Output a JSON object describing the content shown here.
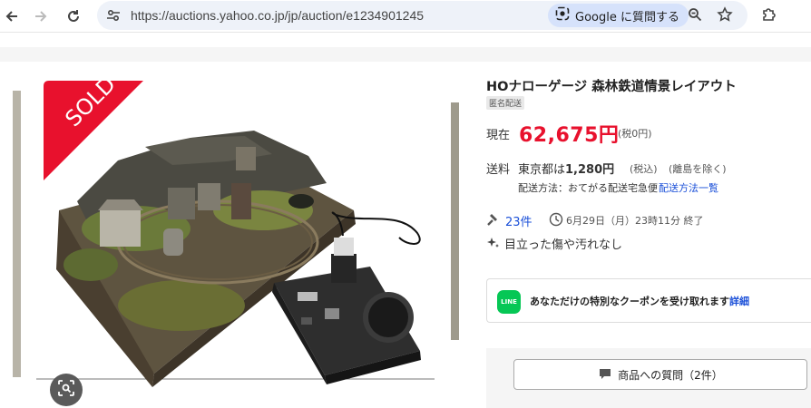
{
  "browser": {
    "url": "https://auctions.yahoo.co.jp/jp/auction/e1234901245",
    "google_chip": "Google に質問する",
    "icons": [
      "back-icon",
      "forward-icon",
      "reload-icon",
      "site-info-icon",
      "google-lens-icon",
      "zoom-icon",
      "bookmark-star-icon",
      "extensions-icon"
    ]
  },
  "gallery": {
    "badge": "SOLD",
    "badge_color": "#e8112d"
  },
  "item": {
    "title": "HOナローゲージ 森林鉄道情景レイアウト",
    "anonymous_tag": "匿名配送",
    "price_label": "現在",
    "price": "62,675円",
    "tax_note": "(税0円)",
    "shipping_label": "送料",
    "shipping_prefix": "東京都は",
    "shipping_amount": "1,280円",
    "shipping_tax": "(税込)",
    "shipping_note": "(離島を除く)",
    "shipping_method": "配送方法：おてがる配送宅急便",
    "shipping_link": "配送方法一覧",
    "bids": "23件",
    "end_time": "6月29日（月）23時11分 終了",
    "condition": "目立った傷や汚れなし",
    "coupon_text": "あなただけの特別なクーポンを受け取れます",
    "coupon_link": "詳細",
    "line_label": "LINE",
    "qa_button": "商品への質問（2件）"
  },
  "colors": {
    "price": "#e8112d",
    "link": "#1a4fd8",
    "line_green": "#06c755"
  }
}
